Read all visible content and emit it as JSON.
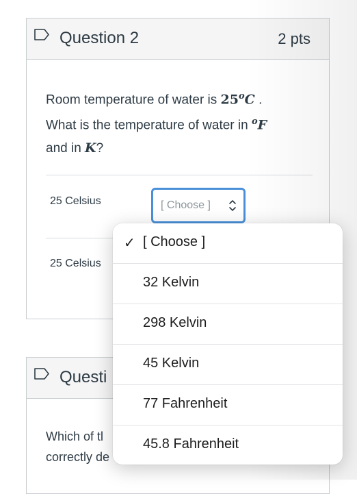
{
  "question2": {
    "title": "Question 2",
    "points": "2 pts",
    "text_line1_pre": "Room temperature of water is ",
    "text_line1_value": "25",
    "text_line1_sup": "o",
    "text_line1_unit": "C",
    "text_line1_post": " .",
    "text_line2_pre": "What is the temperature of water in ",
    "text_line2_sup": "o",
    "text_line2_unit": "F",
    "text_line3_pre": "and in ",
    "text_line3_unit": "K",
    "text_line3_post": "?",
    "rows": [
      {
        "label": "25 Celsius",
        "selected": "[ Choose ]"
      },
      {
        "label": "25 Celsius"
      }
    ]
  },
  "question3": {
    "title_partial": "Questi",
    "text_line1": "Which of tl",
    "text_line2": "correctly de"
  },
  "dropdown": {
    "selected_index": 0,
    "check_glyph": "✓",
    "options": [
      "[ Choose ]",
      "32 Kelvin",
      "298 Kelvin",
      "45 Kelvin",
      "77 Fahrenheit",
      "45.8 Fahrenheit"
    ]
  },
  "colors": {
    "focus_ring": "#4a90d9",
    "header_bg": "#f5f5f5",
    "border": "#c7cdd1"
  },
  "icons": {
    "flag": "flag-icon",
    "select_arrows": "updown-chevron-icon",
    "check": "checkmark-icon"
  }
}
